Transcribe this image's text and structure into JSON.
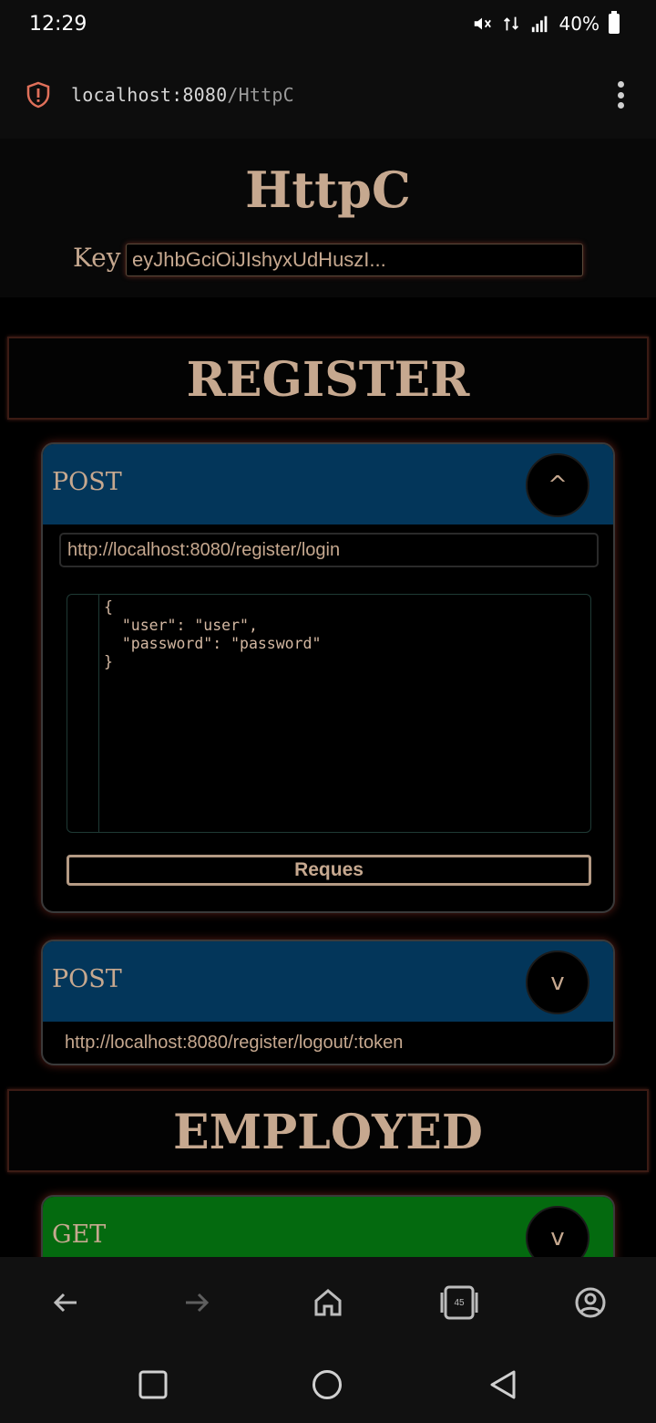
{
  "status_bar": {
    "time": "12:29",
    "battery": "40%"
  },
  "browser": {
    "url_host": "localhost:8080",
    "url_path": "/HttpC",
    "tab_count": "45"
  },
  "header": {
    "title": "HttpC",
    "key_label": "Key",
    "key_value": "eyJhbGciOiJIshyxUdHuszI..."
  },
  "sections": [
    {
      "title": "REGISTER",
      "cards": [
        {
          "method": "POST",
          "toggle": "^",
          "url": "http://localhost:8080/register/login",
          "body": "{\n  \"user\": \"user\",\n  \"password\": \"password\"\n}",
          "button": "Reques"
        },
        {
          "method": "POST",
          "toggle": "v",
          "url": "http://localhost:8080/register/logout/:token"
        }
      ]
    },
    {
      "title": "EMPLOYED",
      "cards": [
        {
          "method": "GET",
          "toggle": "v"
        }
      ]
    }
  ],
  "colors": {
    "accent": "#c6a88f",
    "post": "#03365a",
    "get": "#046a0f",
    "bg": "#000000"
  },
  "icons": [
    "shield-alert-icon",
    "more-vert-icon",
    "back-icon",
    "forward-icon",
    "home-icon",
    "tabs-icon",
    "account-icon",
    "recents-icon",
    "home-circle-icon",
    "back-triangle-icon"
  ]
}
